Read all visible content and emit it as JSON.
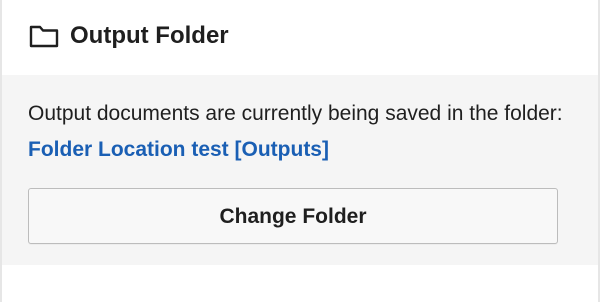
{
  "panel": {
    "icon": "folder-icon",
    "title": "Output Folder",
    "message_prefix": "Output documents are currently being saved in the folder: ",
    "folder_link": "Folder Location test [Outputs]",
    "change_button": "Change Folder"
  },
  "colors": {
    "link": "#1a5fb4",
    "text": "#1f1f1f",
    "body_bg": "#f5f5f5"
  }
}
